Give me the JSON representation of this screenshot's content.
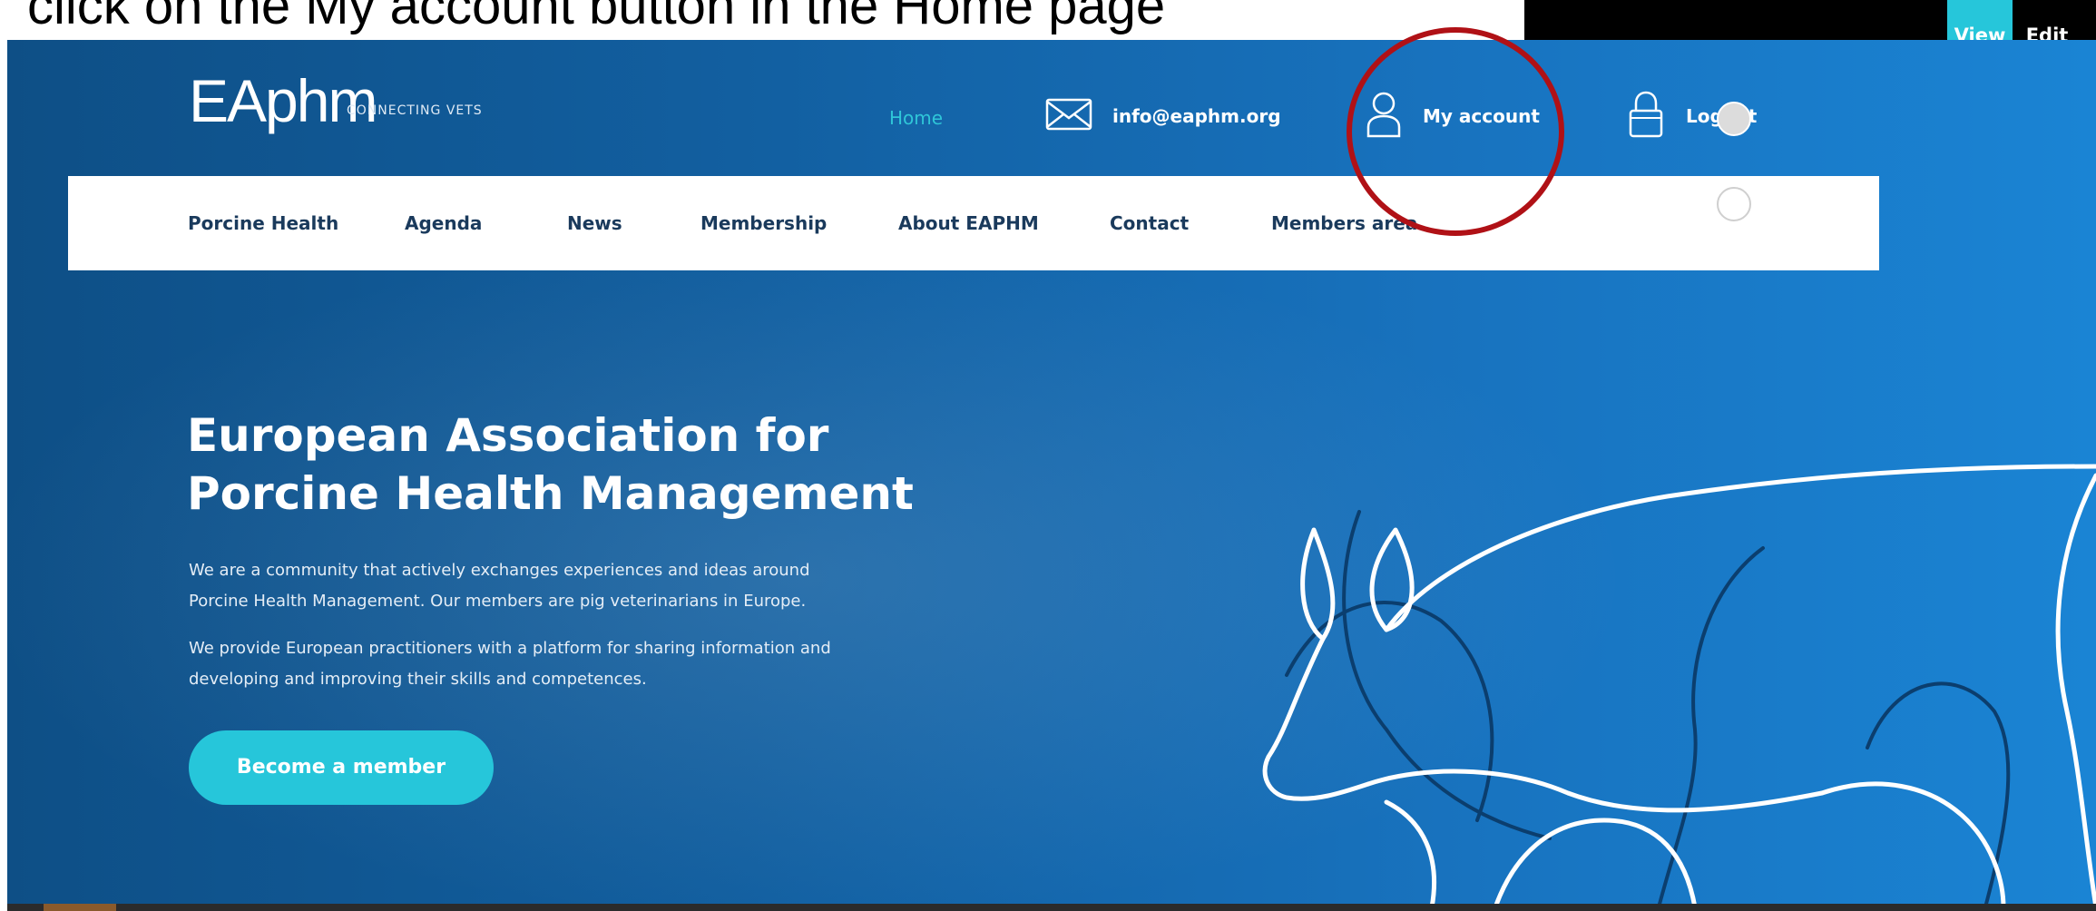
{
  "caption": "click on the My account button in the Home page",
  "admin_bar": {
    "view_label": "View",
    "edit_label": "Edit"
  },
  "header": {
    "logo_text": "EAphm",
    "logo_tagline": "CONNECTING VETS",
    "home_label": "Home",
    "email_label": "info@eaphm.org",
    "account_label": "My account",
    "logout_label": "Logout"
  },
  "nav": {
    "items": [
      {
        "label": "Porcine Health"
      },
      {
        "label": "Agenda"
      },
      {
        "label": "News"
      },
      {
        "label": "Membership"
      },
      {
        "label": "About EAPHM"
      },
      {
        "label": "Contact"
      },
      {
        "label": "Members area"
      }
    ]
  },
  "hero": {
    "title_line1": "European Association for",
    "title_line2": "Porcine Health Management",
    "paragraph1_line1": "We are a community that actively exchanges experiences and ideas around",
    "paragraph1_line2": "Porcine Health Management. Our members are pig veterinarians in Europe.",
    "paragraph2_line1": "We provide European practitioners with a platform for sharing information and",
    "paragraph2_line2": "developing and improving their skills and competences.",
    "cta_label": "Become a member"
  },
  "colors": {
    "accent": "#26c6da",
    "hero_blue": "#1873bf",
    "highlight_circle": "#b01116"
  }
}
